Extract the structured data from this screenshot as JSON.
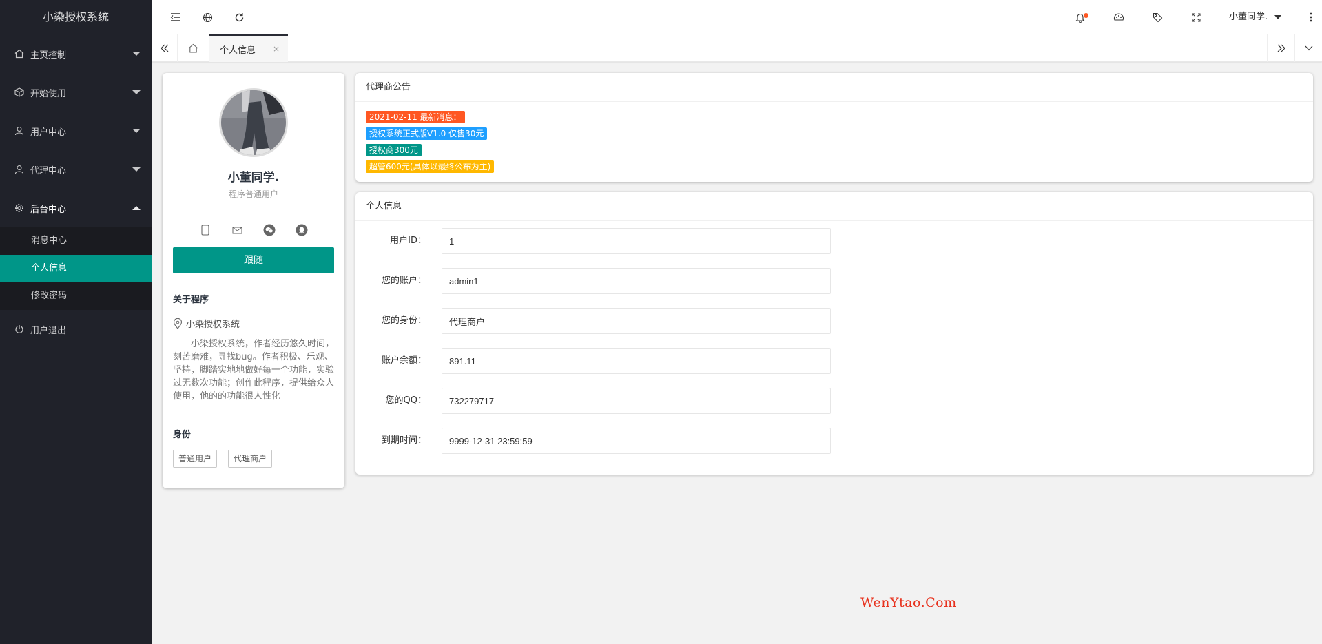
{
  "app_title": "小染授权系统",
  "sidebar": {
    "items": [
      {
        "label": "主页控制",
        "icon": "home-icon"
      },
      {
        "label": "开始使用",
        "icon": "cube-icon"
      },
      {
        "label": "用户中心",
        "icon": "user-icon"
      },
      {
        "label": "代理中心",
        "icon": "user-icon"
      },
      {
        "label": "后台中心",
        "icon": "gear-icon",
        "expanded": true
      }
    ],
    "sub_items": [
      {
        "label": "消息中心"
      },
      {
        "label": "个人信息",
        "active": true
      },
      {
        "label": "修改密码"
      }
    ],
    "logout": {
      "label": "用户退出",
      "icon": "power-icon"
    }
  },
  "header": {
    "user_name": "小董同学.",
    "icons": [
      "menu-toggle-icon",
      "globe-icon",
      "refresh-icon",
      "bell-icon",
      "theme-icon",
      "tag-icon",
      "fullscreen-icon",
      "more-icon"
    ]
  },
  "tabs": {
    "active_label": "个人信息",
    "close_glyph": "×"
  },
  "profile": {
    "name": "小董同学.",
    "role": "程序普通用户",
    "follow_label": "跟随",
    "about_title": "关于程序",
    "location": "小染授权系统",
    "description": "小染授权系统，作者经历悠久时间，刻苦磨难，寻找bug。作者积极、乐观、坚持，脚踏实地地做好每一个功能，实验过无数次功能；创作此程序，提供给众人使用，他的的功能很人性化",
    "identity_title": "身份",
    "tags": [
      "普通用户",
      "代理商户"
    ]
  },
  "notice": {
    "title": "代理商公告",
    "items": [
      {
        "text": "2021-02-11 最新消息：",
        "color": "#ff5722"
      },
      {
        "text": "授权系统正式版V1.0 仅售30元",
        "color": "#1e9fff"
      },
      {
        "text": "授权商300元",
        "color": "#009688"
      },
      {
        "text": "超管600元(具体以最终公布为主)",
        "color": "#ffb800"
      }
    ]
  },
  "info": {
    "title": "个人信息",
    "fields": [
      {
        "label": "用户ID：",
        "value": "1"
      },
      {
        "label": "您的账户：",
        "value": "admin1"
      },
      {
        "label": "您的身份：",
        "value": "代理商户"
      },
      {
        "label": "账户余额：",
        "value": "891.11"
      },
      {
        "label": "您的QQ：",
        "value": "732279717"
      },
      {
        "label": "到期时间：",
        "value": "9999-12-31 23:59:59"
      }
    ]
  },
  "watermark": "WenYtao.Com",
  "colors": {
    "accent": "#009688",
    "sidebar": "#20222a",
    "notify_dot": "#ff5722"
  }
}
